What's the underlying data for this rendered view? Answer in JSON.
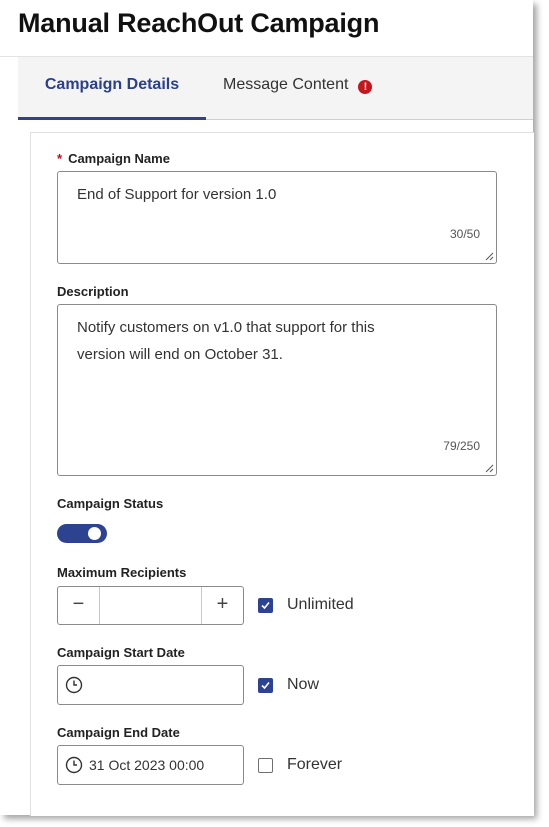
{
  "page_title": "Manual ReachOut Campaign",
  "tabs": [
    {
      "label": "Campaign Details",
      "active": true
    },
    {
      "label": "Message Content",
      "active": false,
      "alert": "!"
    }
  ],
  "form": {
    "campaign_name": {
      "required_mark": "*",
      "label": "Campaign Name",
      "value": "End of Support for version 1.0",
      "counter": "30/50"
    },
    "description": {
      "label": "Description",
      "value": "Notify customers on v1.0 that support for this version will end on October 31.",
      "counter": "79/250"
    },
    "campaign_status": {
      "label": "Campaign Status",
      "enabled": true
    },
    "maximum_recipients": {
      "label": "Maximum Recipients",
      "value": "",
      "minus": "−",
      "plus": "+",
      "unlimited_label": "Unlimited",
      "unlimited_checked": true
    },
    "start_date": {
      "label": "Campaign Start Date",
      "value": "",
      "now_label": "Now",
      "now_checked": true
    },
    "end_date": {
      "label": "Campaign End Date",
      "value": "31 Oct 2023 00:00",
      "forever_label": "Forever",
      "forever_checked": false
    }
  },
  "colors": {
    "accent": "#2d4391",
    "alert": "#c4161c",
    "required": "#d0021b"
  },
  "icons": [
    "alert-icon",
    "clock-icon",
    "checkmark-icon",
    "resize-handle-icon"
  ]
}
